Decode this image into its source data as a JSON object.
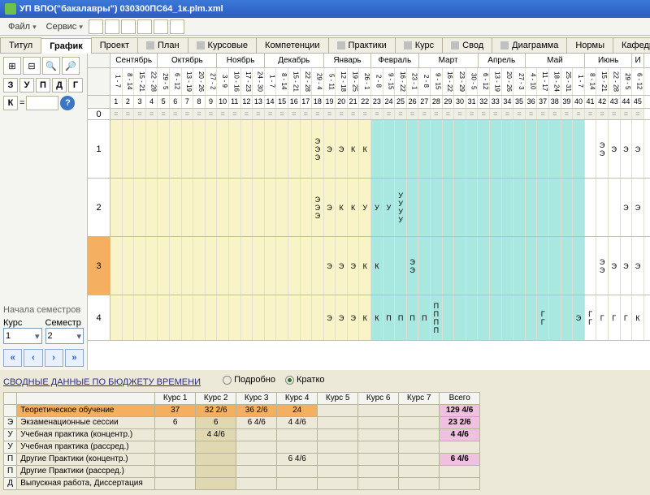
{
  "title": "УП ВПО(\"бакалавры\") 030300ПС64_1к.plm.xml",
  "menu": {
    "file": "Файл",
    "service": "Сервис"
  },
  "tabs": [
    "Титул",
    "График",
    "Проект",
    "План",
    "Курсовые",
    "Компетенции",
    "Практики",
    "Курс",
    "Свод",
    "Диаграмма",
    "Нормы",
    "Кафедры"
  ],
  "letters": [
    "З",
    "У",
    "П",
    "Д",
    "Г"
  ],
  "k_label": "К",
  "eq": "=",
  "panel_title": "Начала семестров",
  "labels": {
    "kurs": "Курс",
    "sem": "Семестр"
  },
  "selects": {
    "kurs": "1",
    "sem": "2"
  },
  "months": [
    "Сентябрь",
    "Октябрь",
    "Ноябрь",
    "Декабрь",
    "Январь",
    "Февраль",
    "Март",
    "Апрель",
    "Май",
    "Июнь",
    "И"
  ],
  "weeks": [
    "1 - 7",
    "8 - 14",
    "15 - 21",
    "22 - 28",
    "29 - 5",
    "6 - 12",
    "13 - 19",
    "20 - 26",
    "27 - 2",
    "3 - 9",
    "10 - 16",
    "17 - 23",
    "24 - 30",
    "1 - 7",
    "8 - 14",
    "15 - 21",
    "22 - 28",
    "29 - 4",
    "5 - 11",
    "12 - 18",
    "19 - 25",
    "26 - 1",
    "2 - 8",
    "9 - 15",
    "16 - 22",
    "23 - 1",
    "2 - 8",
    "9 - 15",
    "16 - 22",
    "23 - 29",
    "30 - 5",
    "6 - 12",
    "13 - 19",
    "20 - 26",
    "27 - 3",
    "4 - 10",
    "11 - 17",
    "18 - 24",
    "25 - 31",
    "1 - 7",
    "8 - 14",
    "15 - 21",
    "22 - 28",
    "29 - 5",
    "6 - 12"
  ],
  "row0": "0",
  "rows": [
    {
      "num": "1",
      "left": [
        "",
        "",
        "",
        "",
        "",
        "",
        "",
        "",
        "",
        "",
        "",
        "",
        "",
        "",
        "",
        "",
        "",
        [
          "Э",
          "Э",
          "Э"
        ],
        "Э",
        "Э",
        "К",
        "К",
        "",
        "",
        "",
        "",
        "",
        "",
        "",
        "",
        "",
        "",
        "",
        "",
        "",
        "",
        "",
        "",
        "",
        "",
        "",
        [
          "Э",
          "Э"
        ],
        "Э",
        "Э",
        "Э"
      ]
    },
    {
      "num": "2",
      "left": [
        "",
        "",
        "",
        "",
        "",
        "",
        "",
        "",
        "",
        "",
        "",
        "",
        "",
        "",
        "",
        "",
        "",
        [
          "Э",
          "Э",
          "Э"
        ],
        "Э",
        "К",
        "К",
        "У",
        "У",
        "У",
        [
          "У",
          "У",
          "У",
          "У"
        ],
        "",
        "",
        "",
        "",
        "",
        "",
        "",
        "",
        "",
        "",
        "",
        "",
        "",
        "",
        "",
        "",
        "",
        "",
        "Э",
        "Э"
      ]
    },
    {
      "num": "3",
      "orange": true,
      "left": [
        "",
        "",
        "",
        "",
        "",
        "",
        "",
        "",
        "",
        "",
        "",
        "",
        "",
        "",
        "",
        "",
        "",
        "",
        "Э",
        "Э",
        "Э",
        "К",
        "К",
        "",
        "",
        [
          "Э",
          "Э"
        ],
        "",
        "",
        "",
        "",
        "",
        "",
        "",
        "",
        "",
        "",
        "",
        "",
        "",
        "",
        "",
        [
          "Э",
          "Э"
        ],
        "Э",
        "Э",
        "Э"
      ]
    },
    {
      "num": "4",
      "left": [
        "",
        "",
        "",
        "",
        "",
        "",
        "",
        "",
        "",
        "",
        "",
        "",
        "",
        "",
        "",
        "",
        "",
        "",
        "Э",
        "Э",
        "Э",
        "К",
        "К",
        "П",
        "П",
        "П",
        "П",
        [
          "П",
          "П",
          "П",
          "П"
        ],
        "",
        "",
        "",
        "",
        "",
        "",
        "",
        "",
        [
          "Г",
          "Г"
        ],
        "",
        "",
        "Э",
        [
          "Г",
          "Г"
        ],
        "Г",
        "Г",
        "Г",
        "К"
      ]
    }
  ],
  "summary_title": "СВОДНЫЕ ДАННЫЕ ПО БЮДЖЕТУ ВРЕМЕНИ",
  "radios": {
    "detail": "Подробно",
    "brief": "Кратко"
  },
  "sum_headers": [
    "Курс 1",
    "Курс 2",
    "Курс 3",
    "Курс 4",
    "Курс 5",
    "Курс 6",
    "Курс 7",
    "Всего"
  ],
  "sum_rows": [
    {
      "code": "",
      "label": "Теоретическое обучение",
      "v": [
        "37",
        "32 2/6",
        "36 2/6",
        "24",
        "",
        "",
        "",
        "129 4/6"
      ],
      "hl": true
    },
    {
      "code": "Э",
      "label": "Экзаменационные сессии",
      "v": [
        "6",
        "6",
        "6 4/6",
        "4 4/6",
        "",
        "",
        "",
        "23 2/6"
      ]
    },
    {
      "code": "У",
      "label": "Учебная практика (концентр.)",
      "v": [
        "",
        "4 4/6",
        "",
        "",
        "",
        "",
        "",
        "4 4/6"
      ]
    },
    {
      "code": "У",
      "label": "Учебная практика (рассред.)",
      "v": [
        "",
        "",
        "",
        "",
        "",
        "",
        "",
        ""
      ]
    },
    {
      "code": "П",
      "label": "Другие Практики (концентр.)",
      "v": [
        "",
        "",
        "",
        "6 4/6",
        "",
        "",
        "",
        "6 4/6"
      ]
    },
    {
      "code": "П",
      "label": "Другие Практики (рассред.)",
      "v": [
        "",
        "",
        "",
        "",
        "",
        "",
        "",
        ""
      ]
    },
    {
      "code": "Д",
      "label": "Выпускная работа, Диссертация",
      "v": [
        "",
        "",
        "",
        "",
        "",
        "",
        "",
        ""
      ]
    }
  ],
  "chart_data": {
    "type": "table",
    "title": "СВОДНЫЕ ДАННЫЕ ПО БЮДЖЕТУ ВРЕМЕНИ",
    "columns": [
      "Курс 1",
      "Курс 2",
      "Курс 3",
      "Курс 4",
      "Курс 5",
      "Курс 6",
      "Курс 7",
      "Всего"
    ],
    "rows": [
      {
        "label": "Теоретическое обучение",
        "values": [
          37,
          32.333,
          36.333,
          24,
          null,
          null,
          null,
          129.667
        ]
      },
      {
        "label": "Экзаменационные сессии",
        "values": [
          6,
          6,
          6.667,
          4.667,
          null,
          null,
          null,
          23.333
        ]
      },
      {
        "label": "Учебная практика (концентр.)",
        "values": [
          null,
          4.667,
          null,
          null,
          null,
          null,
          null,
          4.667
        ]
      },
      {
        "label": "Учебная практика (рассред.)",
        "values": [
          null,
          null,
          null,
          null,
          null,
          null,
          null,
          null
        ]
      },
      {
        "label": "Другие Практики (концентр.)",
        "values": [
          null,
          null,
          null,
          6.667,
          null,
          null,
          null,
          6.667
        ]
      },
      {
        "label": "Другие Практики (рассред.)",
        "values": [
          null,
          null,
          null,
          null,
          null,
          null,
          null,
          null
        ]
      },
      {
        "label": "Выпускная работа, Диссертация",
        "values": [
          null,
          null,
          null,
          null,
          null,
          null,
          null,
          null
        ]
      }
    ]
  }
}
